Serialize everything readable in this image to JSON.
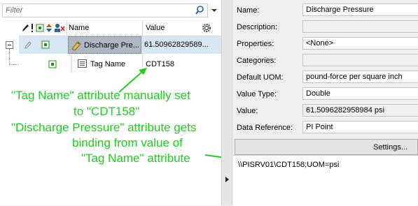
{
  "filter": {
    "placeholder": "Filter"
  },
  "icons": {
    "search": "search-icon",
    "dropdown": "chevron-down-icon",
    "expand": "collapse-icon",
    "attribute": "attribute-icon",
    "pi_point": "pi-point-icon",
    "string_table": "table-icon",
    "settings": "gear-icon",
    "splitter_arrow": "chevron-right-icon"
  },
  "grid": {
    "columns": {
      "name": "Name",
      "value": "Value"
    },
    "rows": [
      {
        "name": "Discharge Pre...",
        "value": "61.50962829589..."
      },
      {
        "name": "Tag Name",
        "value": "CDT158"
      }
    ]
  },
  "annotations": {
    "note1_line1": "\"Tag Name\" attribute manually set",
    "note1_line2": "to \"CDT158\"",
    "note2_line1": "\"Discharge Pressure\" attribute gets",
    "note2_line2": "binding from value of",
    "note2_line3": "\"Tag Name\" attribute"
  },
  "properties": {
    "name": {
      "label": "Name:",
      "value": "Discharge Pressure"
    },
    "description": {
      "label": "Description:",
      "value": ""
    },
    "props": {
      "label": "Properties:",
      "value": "<None>"
    },
    "categories": {
      "label": "Categories:",
      "value": ""
    },
    "default_uom": {
      "label": "Default UOM:",
      "value": "pound-force per square inch"
    },
    "value_type": {
      "label": "Value Type:",
      "value": "Double"
    },
    "value": {
      "label": "Value:",
      "value": "61.5096282958984 psi"
    },
    "data_reference": {
      "label": "Data Reference:",
      "value": "PI Point"
    },
    "settings_label": "Settings...",
    "config_string": "\\\\PISRV01\\CDT158;UOM=psi"
  },
  "colors": {
    "annotation": "#22cc22",
    "selection_row": "#d9e6f3",
    "selected_cell": "#aeb7c2"
  }
}
